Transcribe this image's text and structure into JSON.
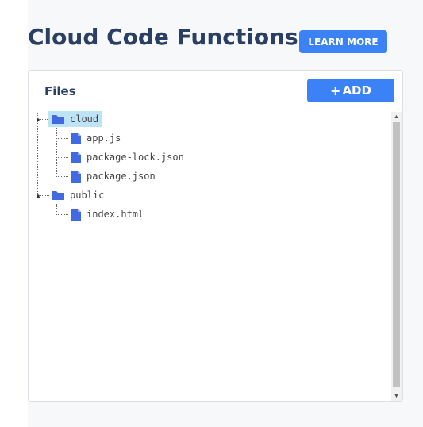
{
  "header": {
    "title": "Cloud Code Functions",
    "learn_more_label": "LEARN MORE"
  },
  "panel": {
    "title": "Files",
    "add_label": "ADD",
    "add_icon": "plus-icon"
  },
  "tree": {
    "folders": [
      {
        "name": "cloud",
        "selected": true,
        "expanded": true,
        "files": [
          "app.js",
          "package-lock.json",
          "package.json"
        ]
      },
      {
        "name": "public",
        "selected": false,
        "expanded": true,
        "files": [
          "index.html"
        ]
      }
    ]
  },
  "colors": {
    "accent": "#3b82f6",
    "title": "#2a3f63",
    "folder_icon": "#4169e1",
    "file_icon": "#4169e1",
    "selected_bg": "#bde3f7"
  }
}
